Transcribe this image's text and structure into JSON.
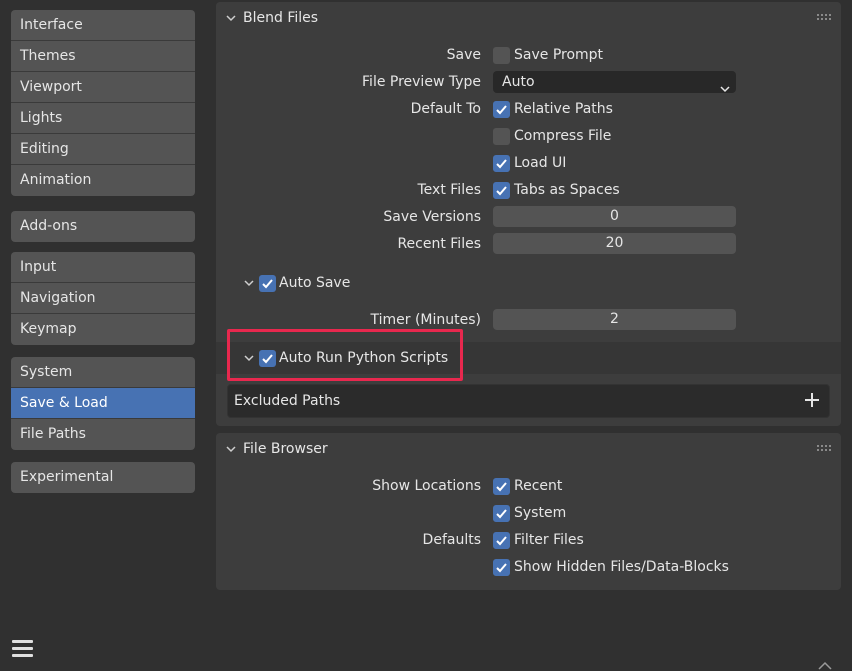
{
  "sidebar": {
    "group1": [
      "Interface",
      "Themes",
      "Viewport",
      "Lights",
      "Editing",
      "Animation"
    ],
    "group2": [
      "Add-ons"
    ],
    "group3": [
      "Input",
      "Navigation",
      "Keymap"
    ],
    "group4": [
      "System",
      "Save & Load",
      "File Paths"
    ],
    "group5": [
      "Experimental"
    ],
    "active": "Save & Load"
  },
  "blend_files": {
    "title": "Blend Files",
    "save_label": "Save",
    "save_prompt": {
      "label": "Save Prompt",
      "checked": false
    },
    "file_preview_label": "File Preview Type",
    "file_preview_value": "Auto",
    "default_to_label": "Default To",
    "relative_paths": {
      "label": "Relative Paths",
      "checked": true
    },
    "compress_file": {
      "label": "Compress File",
      "checked": false
    },
    "load_ui": {
      "label": "Load UI",
      "checked": true
    },
    "text_files_label": "Text Files",
    "tabs_as_spaces": {
      "label": "Tabs as Spaces",
      "checked": true
    },
    "save_versions_label": "Save Versions",
    "save_versions_value": "0",
    "recent_files_label": "Recent Files",
    "recent_files_value": "20",
    "auto_save": {
      "label": "Auto Save",
      "checked": true
    },
    "timer_label": "Timer (Minutes)",
    "timer_value": "2",
    "auto_run": {
      "label": "Auto Run Python Scripts",
      "checked": true
    },
    "excluded_paths_label": "Excluded Paths"
  },
  "file_browser": {
    "title": "File Browser",
    "show_locations_label": "Show Locations",
    "recent": {
      "label": "Recent",
      "checked": true
    },
    "system": {
      "label": "System",
      "checked": true
    },
    "defaults_label": "Defaults",
    "filter_files": {
      "label": "Filter Files",
      "checked": true
    },
    "show_hidden": {
      "label": "Show Hidden Files/Data-Blocks",
      "checked": true
    }
  },
  "colors": {
    "accent": "#4772b3",
    "highlight": "#e8284e",
    "panel": "#3d3d3d",
    "background": "#303030"
  }
}
